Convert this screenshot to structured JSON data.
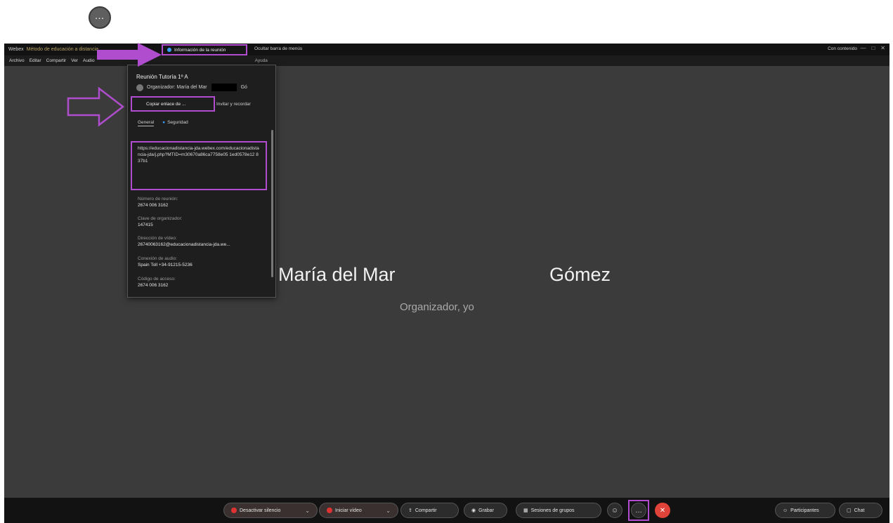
{
  "top_icon": {
    "name": "more-options-icon",
    "glyph": "…"
  },
  "titlebar": {
    "app_name": "Webex",
    "app_subtitle": "Método de educación a distancia",
    "meeting_info_label": "Información de la reunión",
    "hide_menu_label": "Ocultar barra de menús",
    "content_label": "Con contenido",
    "window_controls": [
      "—",
      "□",
      "✕"
    ]
  },
  "menubar": {
    "items": [
      "Archivo",
      "Editar",
      "Compartir",
      "Ver",
      "Audio"
    ],
    "extra": "Ayuda"
  },
  "stage": {
    "first_name": "María del Mar",
    "last_name": "Gómez",
    "role": "Organizador, yo"
  },
  "popup": {
    "title": "Reunión Tutoría 1º A",
    "host_prefix": "Organizador: María del Mar",
    "host_suffix": "Gó",
    "copy_link_label": "Copiar enlace de ...",
    "invite_label": "Invitar y recordar",
    "tab_general": "General",
    "tab_security": "Seguridad",
    "link_text": "https://educacionadistancia-jda.webex.com/educacionadistancia-jda/j.php?MTID=m30670a86ca7758e05 1ed0578e12 837b1",
    "fields": [
      {
        "label": "Número de reunión:",
        "value": "2674 006 3162"
      },
      {
        "label": "Clave de organizador:",
        "value": "147415"
      },
      {
        "label": "Dirección de vídeo:",
        "value": "26740063162@educacionadistancia-jda.we..."
      },
      {
        "label": "Conexión de audio:",
        "value": "Spain Toll +34-91215-5236"
      },
      {
        "label": "Código de acceso:",
        "value": "2674 006 3162"
      }
    ]
  },
  "toolbar": {
    "mute_label": "Desactivar silencio",
    "video_label": "Iniciar vídeo",
    "share_label": "Compartir",
    "record_label": "Grabar",
    "groups_label": "Sesiones de grupos",
    "participants_label": "Participantes",
    "chat_label": "Chat",
    "more_glyph": "…",
    "end_glyph": "✕",
    "react_glyph": "☺"
  },
  "colors": {
    "accent_highlight": "#b04dcf",
    "end_call": "#e0433a",
    "background": "#3b3b3b"
  }
}
